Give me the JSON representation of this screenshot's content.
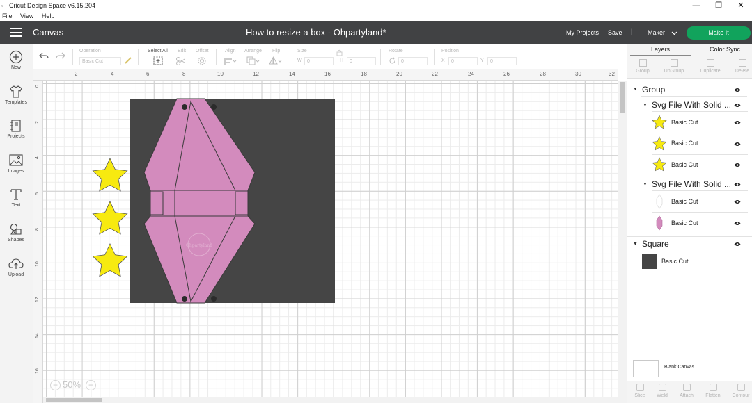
{
  "window": {
    "title": "Cricut Design Space  v6.15.204",
    "menu": [
      "File",
      "View",
      "Help"
    ],
    "controls": {
      "minimize": "—",
      "restore": "❐",
      "close": "✕"
    }
  },
  "header": {
    "section": "Canvas",
    "project_title": "How to resize a box - Ohpartyland*",
    "my_projects": "My Projects",
    "save": "Save",
    "separator": "|",
    "machine": "Maker",
    "make_it": "Make It",
    "make_it_color": "#11a35c"
  },
  "toolbar": {
    "operation": {
      "label": "Operation",
      "value": "Basic Cut"
    },
    "select_all": "Select All",
    "edit": "Edit",
    "offset": "Offset",
    "align": "Align",
    "arrange": "Arrange",
    "flip": "Flip",
    "size": {
      "label": "Size",
      "w_label": "W",
      "w_value": "0",
      "h_label": "H",
      "h_value": "0"
    },
    "rotate": {
      "label": "Rotate",
      "value": "0"
    },
    "position": {
      "label": "Position",
      "x_label": "X",
      "x_value": "0",
      "y_label": "Y",
      "y_value": "0"
    }
  },
  "sidebar": {
    "items": [
      {
        "label": "New",
        "icon": "plus-circle-icon"
      },
      {
        "label": "Templates",
        "icon": "shirt-icon"
      },
      {
        "label": "Projects",
        "icon": "notebook-icon"
      },
      {
        "label": "Images",
        "icon": "image-icon"
      },
      {
        "label": "Text",
        "icon": "text-t-icon"
      },
      {
        "label": "Shapes",
        "icon": "shapes-icon"
      },
      {
        "label": "Upload",
        "icon": "cloud-upload-icon"
      }
    ]
  },
  "rulers": {
    "top": [
      "2",
      "4",
      "6",
      "8",
      "10",
      "12",
      "14",
      "16",
      "18",
      "20",
      "22",
      "24",
      "26",
      "28",
      "30",
      "32"
    ],
    "left": [
      "0",
      "2",
      "4",
      "6",
      "8",
      "10",
      "12",
      "14",
      "16"
    ]
  },
  "canvas": {
    "zoom": "50%",
    "zoom_minus": "−",
    "zoom_plus": "+",
    "square_color": "#454545",
    "box_color": "#d38bbd",
    "star_color": "#f7ea10",
    "watermark": "Ohpartyland"
  },
  "right_panel": {
    "tabs": [
      "Layers",
      "Color Sync"
    ],
    "tools": [
      "Group",
      "UnGroup",
      "Duplicate",
      "Delete"
    ],
    "layers": {
      "group": "Group",
      "subgroup1": "Svg File With Solid ...",
      "subgroup1_items": [
        "Basic Cut",
        "Basic Cut",
        "Basic Cut"
      ],
      "subgroup2": "Svg File With Solid ...",
      "subgroup2_items": [
        "Basic Cut",
        "Basic Cut"
      ],
      "square": "Square",
      "square_item": "Basic Cut"
    },
    "blank_canvas": "Blank Canvas",
    "bottom_tools": [
      "Slice",
      "Weld",
      "Attach",
      "Flatten",
      "Contour"
    ]
  }
}
